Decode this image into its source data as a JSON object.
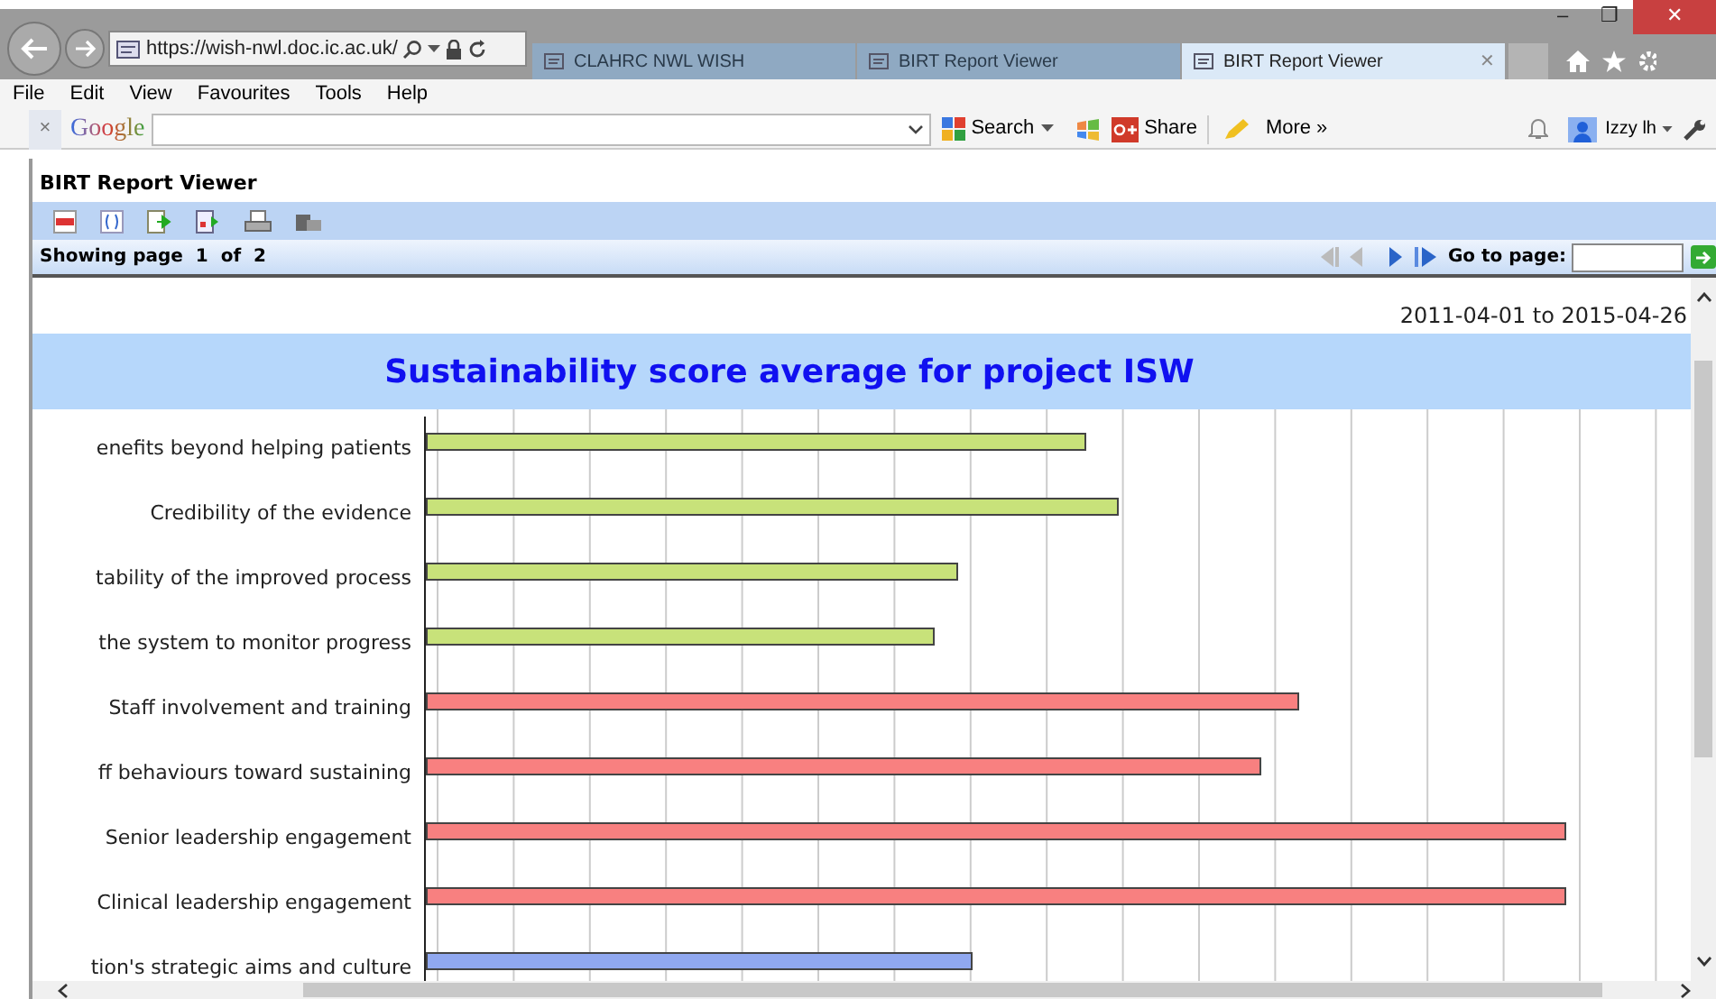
{
  "window": {
    "controls": [
      "–",
      "❐",
      "✕"
    ]
  },
  "address_bar": {
    "url": "https://wish-nwl.doc.ic.ac.uk/"
  },
  "tabs": [
    {
      "label": "CLAHRC NWL WISH",
      "selected": false
    },
    {
      "label": "BIRT Report Viewer",
      "selected": false
    },
    {
      "label": "BIRT Report Viewer",
      "selected": true,
      "close": "✕"
    }
  ],
  "menu": [
    "File",
    "Edit",
    "View",
    "Favourites",
    "Tools",
    "Help"
  ],
  "google_toolbar": {
    "close": "×",
    "logo": "Google",
    "search": "Search",
    "share": "Share",
    "more": "More »",
    "user": "Izzy lh"
  },
  "viewer": {
    "title": "BIRT Report Viewer",
    "page_info": "Showing page  1  of  2",
    "goto_label": "Go to page:"
  },
  "report": {
    "date_range": "2011-04-01 to 2015-04-26",
    "title": "Sustainability score average for project ISW",
    "bars": [
      {
        "label": "enefits beyond helping patients",
        "color": "#c8e27a",
        "level": 0.536
      },
      {
        "label": "Credibility of the evidence",
        "color": "#c8e27a",
        "level": 0.562
      },
      {
        "label": "tability of the improved process",
        "color": "#c8e27a",
        "level": 0.432
      },
      {
        "label": "the system to monitor progress",
        "color": "#c8e27a",
        "level": 0.413
      },
      {
        "label": "Staff involvement and training",
        "color": "#f88080",
        "level": 0.709
      },
      {
        "label": "ff behaviours toward sustaining",
        "color": "#f88080",
        "level": 0.678
      },
      {
        "label": "Senior leadership engagement",
        "color": "#f88080",
        "level": 0.925
      },
      {
        "label": "Clinical leadership engagement",
        "color": "#f88080",
        "level": 0.925
      },
      {
        "label": "tion's strategic aims and culture",
        "color": "#90a8f0",
        "level": 0.444
      }
    ]
  }
}
